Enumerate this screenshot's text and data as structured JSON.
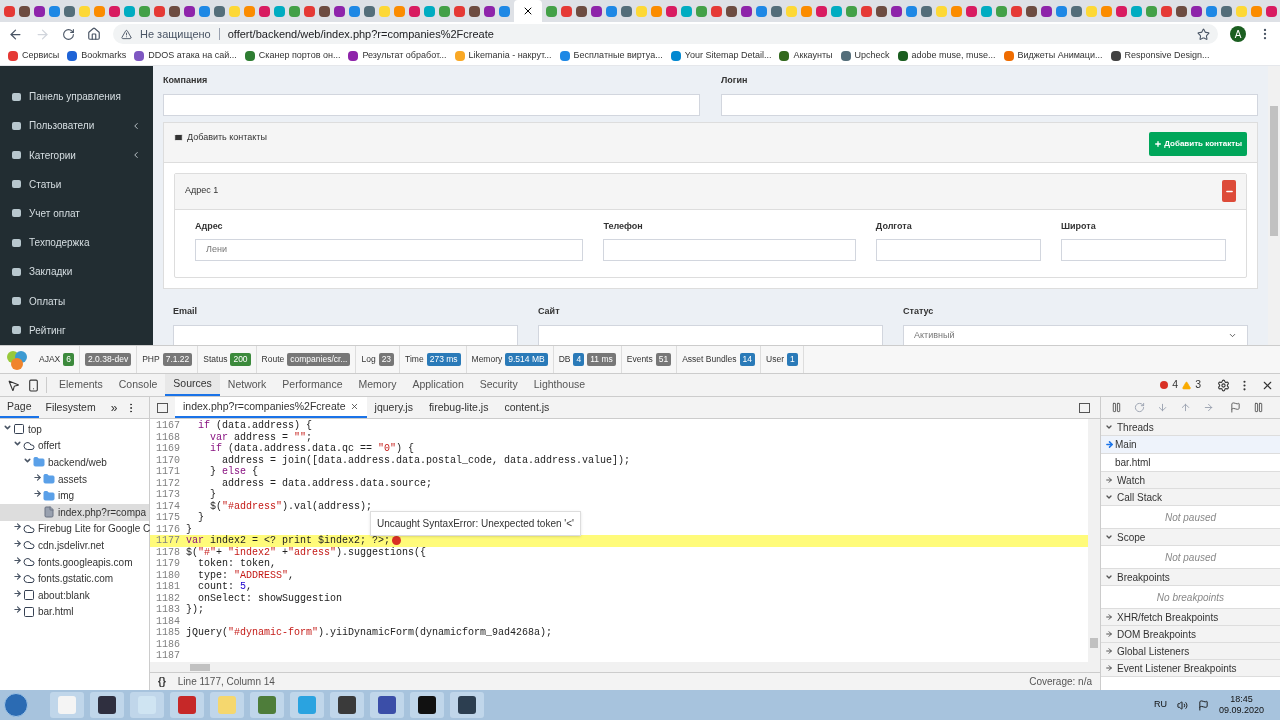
{
  "browser": {
    "security": "Не защищено",
    "url": "offert/backend/web/index.php?r=companies%2Fcreate",
    "profile": "A"
  },
  "bookmarks": [
    {
      "label": "Сервисы",
      "color": "#e53935"
    },
    {
      "label": "Bookmarks",
      "color": "#1e63d6"
    },
    {
      "label": "DDOS атака на сай...",
      "color": "#7e57c2"
    },
    {
      "label": "Сканер портов он...",
      "color": "#2e7d32"
    },
    {
      "label": "Результат обработ...",
      "color": "#8e24aa"
    },
    {
      "label": "Likemania - накрут...",
      "color": "#f9a825"
    },
    {
      "label": "Бесплатные виртуа...",
      "color": "#1e88e5"
    },
    {
      "label": "Your Sitemap Detail...",
      "color": "#0288d1"
    },
    {
      "label": "Аккаунты",
      "color": "#33691e"
    },
    {
      "label": "Upcheck",
      "color": "#546e7a"
    },
    {
      "label": "adobe muse, muse...",
      "color": "#1b5e20"
    },
    {
      "label": "Виджеты Анимаци...",
      "color": "#ef6c00"
    },
    {
      "label": "Responsive Design...",
      "color": "#424242"
    }
  ],
  "sidebar": {
    "items": [
      {
        "label": "Панель управления",
        "has_submenu": false
      },
      {
        "label": "Пользователи",
        "has_submenu": true
      },
      {
        "label": "Категории",
        "has_submenu": true
      },
      {
        "label": "Статьи",
        "has_submenu": false
      },
      {
        "label": "Учет оплат",
        "has_submenu": false
      },
      {
        "label": "Техподержка",
        "has_submenu": false
      },
      {
        "label": "Закладки",
        "has_submenu": false
      },
      {
        "label": "Оплаты",
        "has_submenu": false
      },
      {
        "label": "Рейтинг",
        "has_submenu": false
      }
    ]
  },
  "form": {
    "top_fields": [
      {
        "label": "Компания"
      },
      {
        "label": "Логин"
      }
    ],
    "contacts": {
      "title": "Добавить контакты",
      "add_button": "Добавить контакты",
      "address": {
        "title": "Адрес 1",
        "fields": [
          {
            "label": "Адрес",
            "value": "Лени"
          },
          {
            "label": "Телефон"
          },
          {
            "label": "Долгота"
          },
          {
            "label": "Широта"
          }
        ]
      }
    },
    "bottom_fields": [
      {
        "label": "Email",
        "kind": "input"
      },
      {
        "label": "Сайт",
        "kind": "input"
      },
      {
        "label": "Статус",
        "kind": "select",
        "value": "Активный"
      }
    ]
  },
  "debug_toolbar": [
    {
      "label": "AJAX",
      "badges": [
        {
          "text": "6",
          "color": "#3c8a3c"
        }
      ]
    },
    {
      "badges": [
        {
          "text": "2.0.38-dev",
          "color": "#777777"
        }
      ]
    },
    {
      "label": "PHP",
      "badges": [
        {
          "text": "7.1.22",
          "color": "#777777"
        }
      ]
    },
    {
      "label": "Status",
      "badges": [
        {
          "text": "200",
          "color": "#3c8a3c"
        }
      ]
    },
    {
      "label": "Route",
      "badges": [
        {
          "text": "companies/cr...",
          "color": "#777777"
        }
      ]
    },
    {
      "label": "Log",
      "badges": [
        {
          "text": "23",
          "color": "#777777"
        }
      ]
    },
    {
      "label": "Time",
      "badges": [
        {
          "text": "273 ms",
          "color": "#2a7ab8"
        }
      ]
    },
    {
      "label": "Memory",
      "badges": [
        {
          "text": "9.514 MB",
          "color": "#2a7ab8"
        }
      ]
    },
    {
      "label": "DB",
      "badges": [
        {
          "text": "4",
          "color": "#2a7ab8"
        },
        {
          "text": "11 ms",
          "color": "#777777"
        }
      ]
    },
    {
      "label": "Events",
      "badges": [
        {
          "text": "51",
          "color": "#777777"
        }
      ]
    },
    {
      "label": "Asset Bundles",
      "badges": [
        {
          "text": "14",
          "color": "#2a7ab8"
        }
      ]
    },
    {
      "label": "User",
      "badges": [
        {
          "text": "1",
          "color": "#2a7ab8"
        }
      ]
    }
  ],
  "devtools": {
    "tabs": [
      {
        "label": "Elements",
        "selected": false
      },
      {
        "label": "Console",
        "selected": false
      },
      {
        "label": "Sources",
        "selected": true
      },
      {
        "label": "Network",
        "selected": false
      },
      {
        "label": "Performance",
        "selected": false
      },
      {
        "label": "Memory",
        "selected": false
      },
      {
        "label": "Application",
        "selected": false
      },
      {
        "label": "Security",
        "selected": false
      },
      {
        "label": "Lighthouse",
        "selected": false
      }
    ],
    "errors": "4",
    "warnings": "3",
    "navigator_tabs": [
      {
        "label": "Page",
        "selected": true
      },
      {
        "label": "Filesystem",
        "selected": false
      }
    ],
    "file_tabs": [
      {
        "label": "index.php?r=companies%2Fcreate",
        "selected": true
      },
      {
        "label": "jquery.js",
        "selected": false
      },
      {
        "label": "firebug-lite.js",
        "selected": false
      },
      {
        "label": "content.js",
        "selected": false
      }
    ],
    "tree": [
      {
        "label": "top",
        "kind": "frame",
        "expanded": true,
        "selected": false,
        "children": [
          {
            "label": "offert",
            "kind": "cloud",
            "expanded": true,
            "selected": false,
            "children": [
              {
                "label": "backend/web",
                "kind": "folder",
                "expanded": true,
                "selected": false,
                "children": [
                  {
                    "label": "assets",
                    "kind": "folder",
                    "expanded": false,
                    "selected": false
                  },
                  {
                    "label": "img",
                    "kind": "folder",
                    "expanded": false,
                    "selected": false
                  },
                  {
                    "label": "index.php?r=compa",
                    "kind": "file",
                    "expanded": false,
                    "selected": true
                  }
                ]
              }
            ]
          },
          {
            "label": "Firebug Lite for Google C",
            "kind": "cloud",
            "expanded": false,
            "selected": false
          },
          {
            "label": "cdn.jsdelivr.net",
            "kind": "cloud",
            "expanded": false,
            "selected": false
          },
          {
            "label": "fonts.googleapis.com",
            "kind": "cloud",
            "expanded": false,
            "selected": false
          },
          {
            "label": "fonts.gstatic.com",
            "kind": "cloud",
            "expanded": false,
            "selected": false
          },
          {
            "label": "about:blank",
            "kind": "frame",
            "expanded": false,
            "selected": false
          },
          {
            "label": "bar.html",
            "kind": "frame",
            "expanded": false,
            "selected": false
          }
        ]
      }
    ],
    "code": [
      {
        "number": "1167",
        "text": "  if (data.address) {",
        "error": false
      },
      {
        "number": "1168",
        "text": "    var address = \"\";",
        "error": false
      },
      {
        "number": "1169",
        "text": "    if (data.address.data.qc == \"0\") {",
        "error": false
      },
      {
        "number": "1170",
        "text": "      address = join([data.address.data.postal_code, data.address.value]);",
        "error": false
      },
      {
        "number": "1171",
        "text": "    } else {",
        "error": false
      },
      {
        "number": "1172",
        "text": "      address = data.address.data.source;",
        "error": false
      },
      {
        "number": "1173",
        "text": "    }",
        "error": false
      },
      {
        "number": "1174",
        "text": "    $(\"#address\").val(address);",
        "error": false
      },
      {
        "number": "1175",
        "text": "  }",
        "error": false
      },
      {
        "number": "1176",
        "text": "}",
        "error": false
      },
      {
        "number": "1177",
        "text": "var index2 = <? print $index2; ?>;",
        "error": true
      },
      {
        "number": "1178",
        "text": "$(\"#\"+ \"index2\" +\"adress\").suggestions({",
        "error": false
      },
      {
        "number": "1179",
        "text": "  token: token,",
        "error": false
      },
      {
        "number": "1180",
        "text": "  type: \"ADDRESS\",",
        "error": false
      },
      {
        "number": "1181",
        "text": "  count: 5,",
        "error": false
      },
      {
        "number": "1182",
        "text": "  onSelect: showSuggestion",
        "error": false
      },
      {
        "number": "1183",
        "text": "});",
        "error": false
      },
      {
        "number": "1184",
        "error": false
      },
      {
        "number": "1185",
        "text": "jQuery(\"#dynamic-form\").yiiDynamicForm(dynamicform_9ad4268a);",
        "error": false
      },
      {
        "number": "1186",
        "error": false
      },
      {
        "number": "1187",
        "error": false
      }
    ],
    "more_tabs": "»",
    "format_button": "{}",
    "error_tooltip": "Uncaught SyntaxError: Unexpected token '<'",
    "status": {
      "position": "Line 1177, Column 14",
      "coverage": "Coverage: n/a"
    },
    "sidebar_sections": [
      {
        "title": "Threads",
        "expanded": true,
        "items": [
          {
            "label": "Main",
            "selected": true
          },
          {
            "label": "bar.html",
            "selected": false
          }
        ]
      },
      {
        "title": "Watch",
        "expanded": false
      },
      {
        "title": "Call Stack",
        "expanded": true,
        "empty_text": "Not paused"
      },
      {
        "title": "Scope",
        "expanded": true,
        "empty_text": "Not paused"
      },
      {
        "title": "Breakpoints",
        "expanded": true,
        "empty_text": "No breakpoints"
      },
      {
        "title": "XHR/fetch Breakpoints",
        "expanded": false
      },
      {
        "title": "DOM Breakpoints",
        "expanded": false
      },
      {
        "title": "Global Listeners",
        "expanded": false
      },
      {
        "title": "Event Listener Breakpoints",
        "expanded": false
      }
    ]
  },
  "taskbar": {
    "language": "RU",
    "time": "18:45",
    "date": "09.09.2020"
  }
}
